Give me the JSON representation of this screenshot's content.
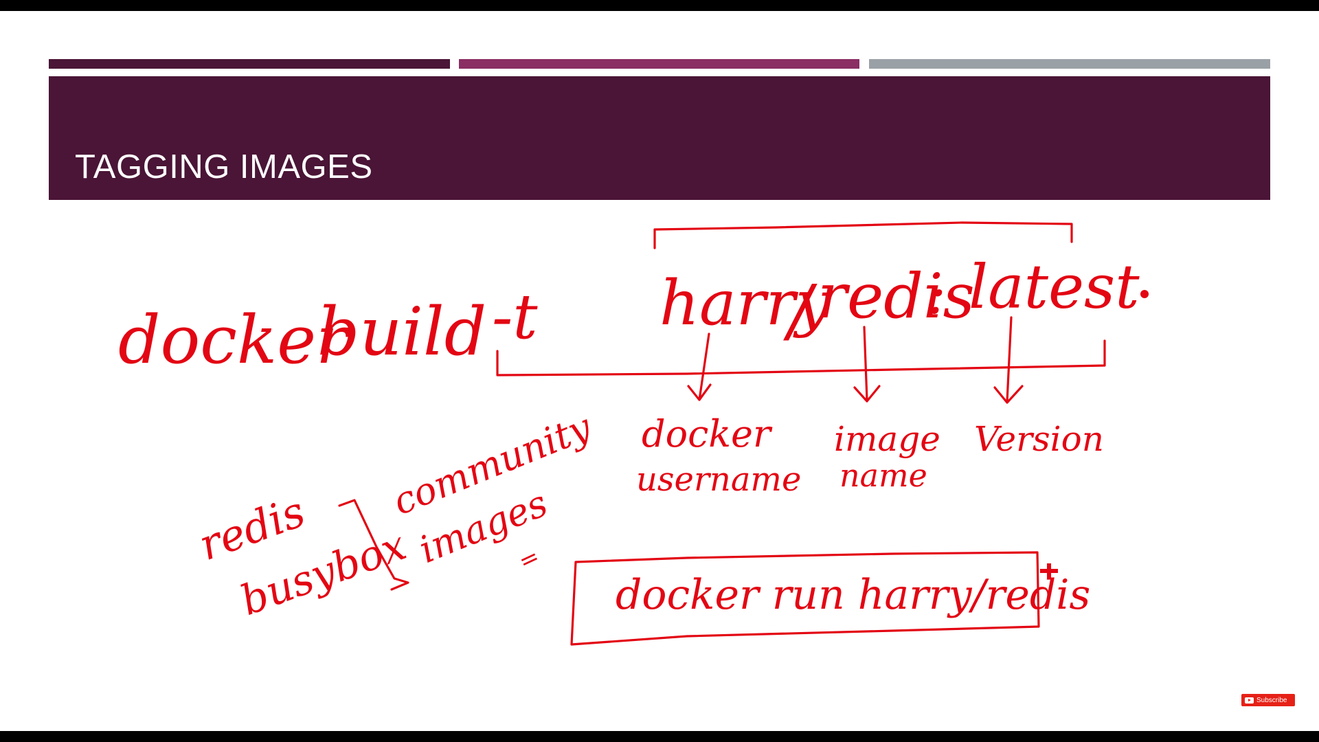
{
  "slide": {
    "title": "TAGGING IMAGES",
    "accent_colors": [
      "#4a1536",
      "#8a2e63",
      "#9aa1a6"
    ],
    "ink_color": "#e30613"
  },
  "annotations": {
    "cmd_docker": "docker",
    "cmd_build": "build",
    "cmd_flag": "-t",
    "tag_user": "harry",
    "tag_slash": "/",
    "tag_name": "redis",
    "tag_colon": ":",
    "tag_version": "latest",
    "build_context": ".",
    "label_user_1": "docker",
    "label_user_2": "username",
    "label_name_1": "image",
    "label_name_2": "name",
    "label_version": "Version",
    "community_item_1": "redis",
    "community_item_2": "busybox",
    "community_label_1": "community",
    "community_label_2": "images",
    "community_mark": "=",
    "run_command": "docker run harry/redis"
  },
  "subscribe": {
    "label": "Subscribe"
  }
}
